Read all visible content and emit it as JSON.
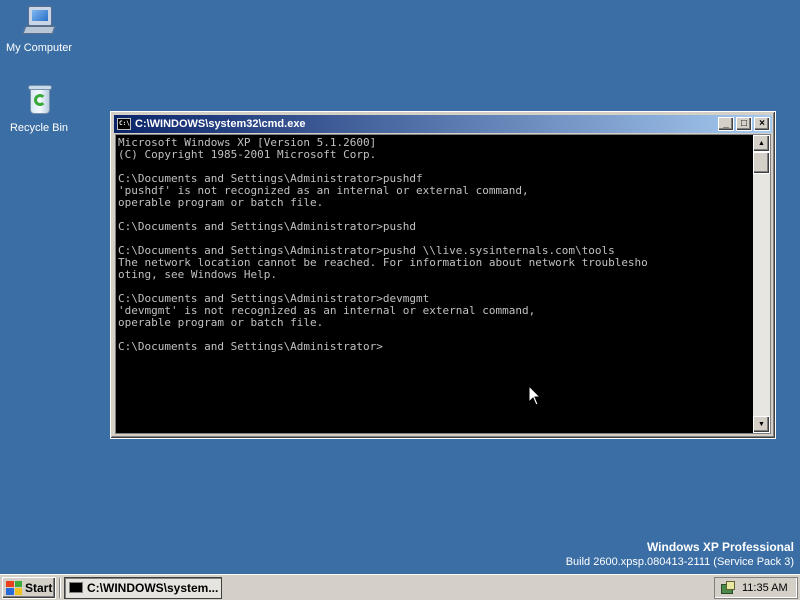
{
  "desktop": {
    "icons": [
      {
        "label": "My Computer",
        "icon": "my-computer-icon"
      },
      {
        "label": "Recycle Bin",
        "icon": "recycle-bin-icon"
      }
    ],
    "background_color": "#3a6ea5"
  },
  "window": {
    "title": "C:\\WINDOWS\\system32\\cmd.exe",
    "title_icon_text": "C:\\",
    "buttons": {
      "minimize": "_",
      "maximize": "□",
      "close": "×"
    },
    "console_lines": [
      "Microsoft Windows XP [Version 5.1.2600]",
      "(C) Copyright 1985-2001 Microsoft Corp.",
      "",
      "C:\\Documents and Settings\\Administrator>pushdf",
      "'pushdf' is not recognized as an internal or external command,",
      "operable program or batch file.",
      "",
      "C:\\Documents and Settings\\Administrator>pushd",
      "",
      "C:\\Documents and Settings\\Administrator>pushd \\\\live.sysinternals.com\\tools",
      "The network location cannot be reached. For information about network troublesho",
      "oting, see Windows Help.",
      "",
      "C:\\Documents and Settings\\Administrator>devmgmt",
      "'devmgmt' is not recognized as an internal or external command,",
      "operable program or batch file.",
      "",
      "C:\\Documents and Settings\\Administrator>"
    ],
    "scrollbar": {
      "up": "▲",
      "down": "▼"
    }
  },
  "watermark": {
    "title": "Windows XP Professional",
    "build": "Build 2600.xpsp.080413-2111 (Service Pack 3)"
  },
  "taskbar": {
    "start_label": "Start",
    "task_label": "C:\\WINDOWS\\system...",
    "clock": "11:35 AM"
  }
}
